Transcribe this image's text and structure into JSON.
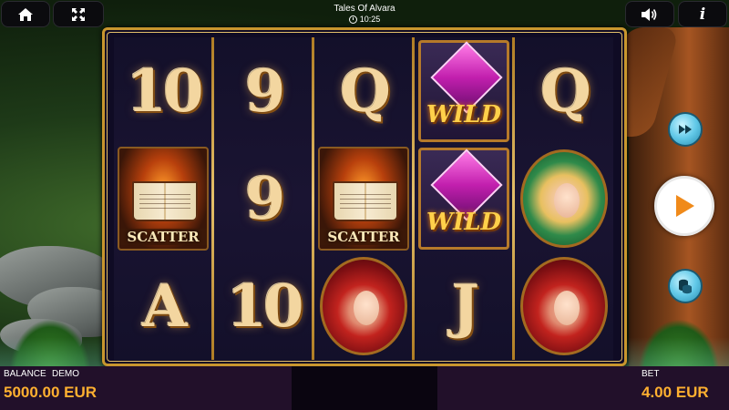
{
  "header": {
    "title": "Tales Of Alvara",
    "time": "10:25",
    "home_icon": "home-icon",
    "fullscreen_icon": "fullscreen-icon",
    "sound_icon": "speaker-icon",
    "info_label": "i"
  },
  "reels": [
    [
      "10",
      "SCATTER",
      "A"
    ],
    [
      "9",
      "9",
      "10"
    ],
    [
      "Q",
      "SCATTER",
      "fairy-red"
    ],
    [
      "WILD",
      "WILD",
      "J"
    ],
    [
      "Q",
      "fairy-blonde",
      "fairy-red"
    ]
  ],
  "symbol_labels": {
    "scatter": "SCATTER",
    "wild": "WILD"
  },
  "controls": {
    "fast_forward_icon": "fast-forward-icon",
    "spin_icon": "play-icon",
    "bet_icon": "coins-icon"
  },
  "footer": {
    "balance_label": "BALANCE",
    "mode_label": "DEMO",
    "balance_value": "5000.00 EUR",
    "bet_label": "BET",
    "bet_value": "4.00 EUR"
  },
  "colors": {
    "accent": "#ffb030",
    "frame_gold": "#c8962e",
    "footer_bg": "#22102a"
  }
}
